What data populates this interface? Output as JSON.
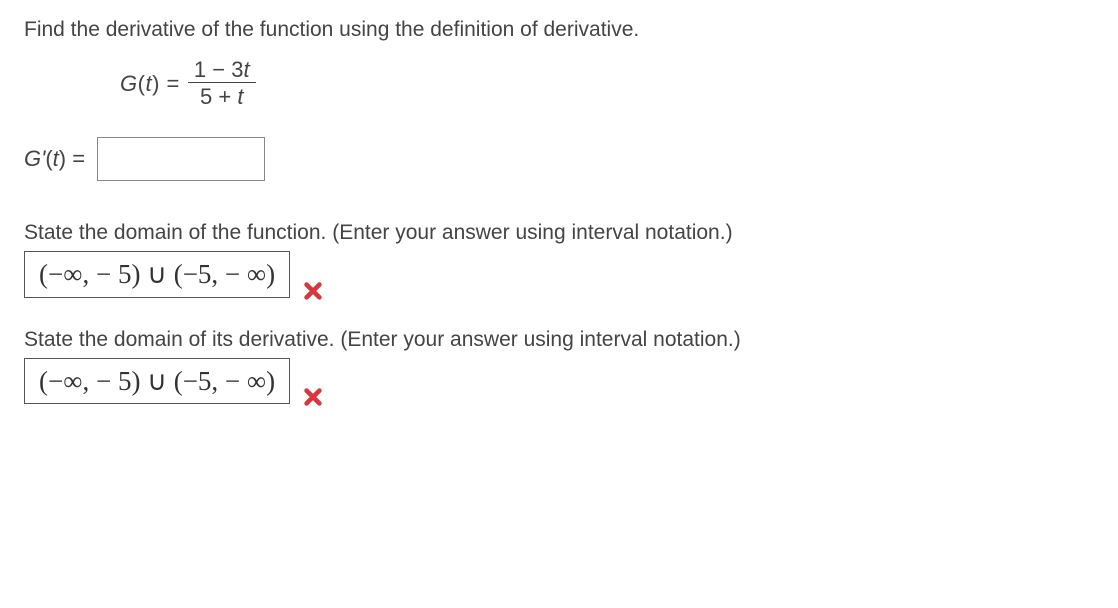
{
  "prompt": "Find the derivative of the function using the definition of derivative.",
  "function_definition": {
    "lhs": "G(t) = ",
    "numerator": "1 − 3t",
    "denominator": "5 + t"
  },
  "derivative_label": "G'(t) = ",
  "derivative_input_value": "",
  "domain_function": {
    "question": "State the domain of the function. (Enter your answer using interval notation.)",
    "student_answer": "(−∞, − 5) ∪ (−5, − ∞)",
    "feedback_icon": "wrong"
  },
  "domain_derivative": {
    "question": "State the domain of its derivative. (Enter your answer using interval notation.)",
    "student_answer": "(−∞, − 5) ∪ (−5, − ∞)",
    "feedback_icon": "wrong"
  }
}
